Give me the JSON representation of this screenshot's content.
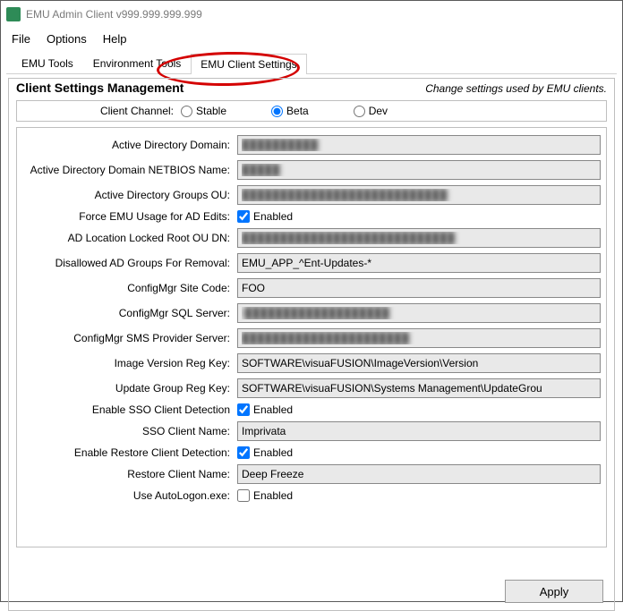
{
  "window": {
    "title": "EMU Admin Client v999.999.999.999"
  },
  "menu": {
    "file": "File",
    "options": "Options",
    "help": "Help"
  },
  "tabs": {
    "emu_tools": "EMU Tools",
    "env_tools": "Environment Tools",
    "client_settings": "EMU Client Settings"
  },
  "panel": {
    "title": "Client Settings Management",
    "subtitle": "Change settings used by EMU clients."
  },
  "channel": {
    "label": "Client Channel:",
    "stable": "Stable",
    "beta": "Beta",
    "dev": "Dev",
    "selected": "beta"
  },
  "enabled_label": "Enabled",
  "fields": {
    "ad_domain": {
      "label": "Active Directory Domain:",
      "value": "██████████"
    },
    "ad_netbios": {
      "label": "Active Directory Domain NETBIOS Name:",
      "value": "█████"
    },
    "ad_groups_ou": {
      "label": "Active Directory Groups OU:",
      "value": "███████████████████████████"
    },
    "force_emu": {
      "label": "Force EMU Usage for AD Edits:",
      "checked": true
    },
    "ad_locked_root": {
      "label": "AD Location Locked Root OU DN:",
      "value": "████████████████████████████"
    },
    "disallowed_groups": {
      "label": "Disallowed AD Groups For Removal:",
      "value": "EMU_APP_^Ent-Updates-*"
    },
    "cfgmgr_site": {
      "label": "ConfigMgr Site Code:",
      "value": "FOO"
    },
    "cfgmgr_sql": {
      "label": "ConfigMgr SQL Server:",
      "value": "I███████████████████"
    },
    "cfgmgr_sms": {
      "label": "ConfigMgr SMS Provider Server:",
      "value": "██████████████████████"
    },
    "img_reg_key": {
      "label": "Image Version Reg Key:",
      "value": "SOFTWARE\\visuaFUSION\\ImageVersion\\Version"
    },
    "update_reg_key": {
      "label": "Update Group Reg Key:",
      "value": "SOFTWARE\\visuaFUSION\\Systems Management\\UpdateGrou"
    },
    "enable_sso": {
      "label": "Enable SSO Client Detection",
      "checked": true
    },
    "sso_name": {
      "label": "SSO Client Name:",
      "value": "Imprivata"
    },
    "enable_restore": {
      "label": "Enable Restore Client Detection:",
      "checked": true
    },
    "restore_name": {
      "label": "Restore Client Name:",
      "value": "Deep Freeze"
    },
    "use_autologon": {
      "label": "Use AutoLogon.exe:",
      "checked": false
    }
  },
  "buttons": {
    "apply": "Apply"
  }
}
